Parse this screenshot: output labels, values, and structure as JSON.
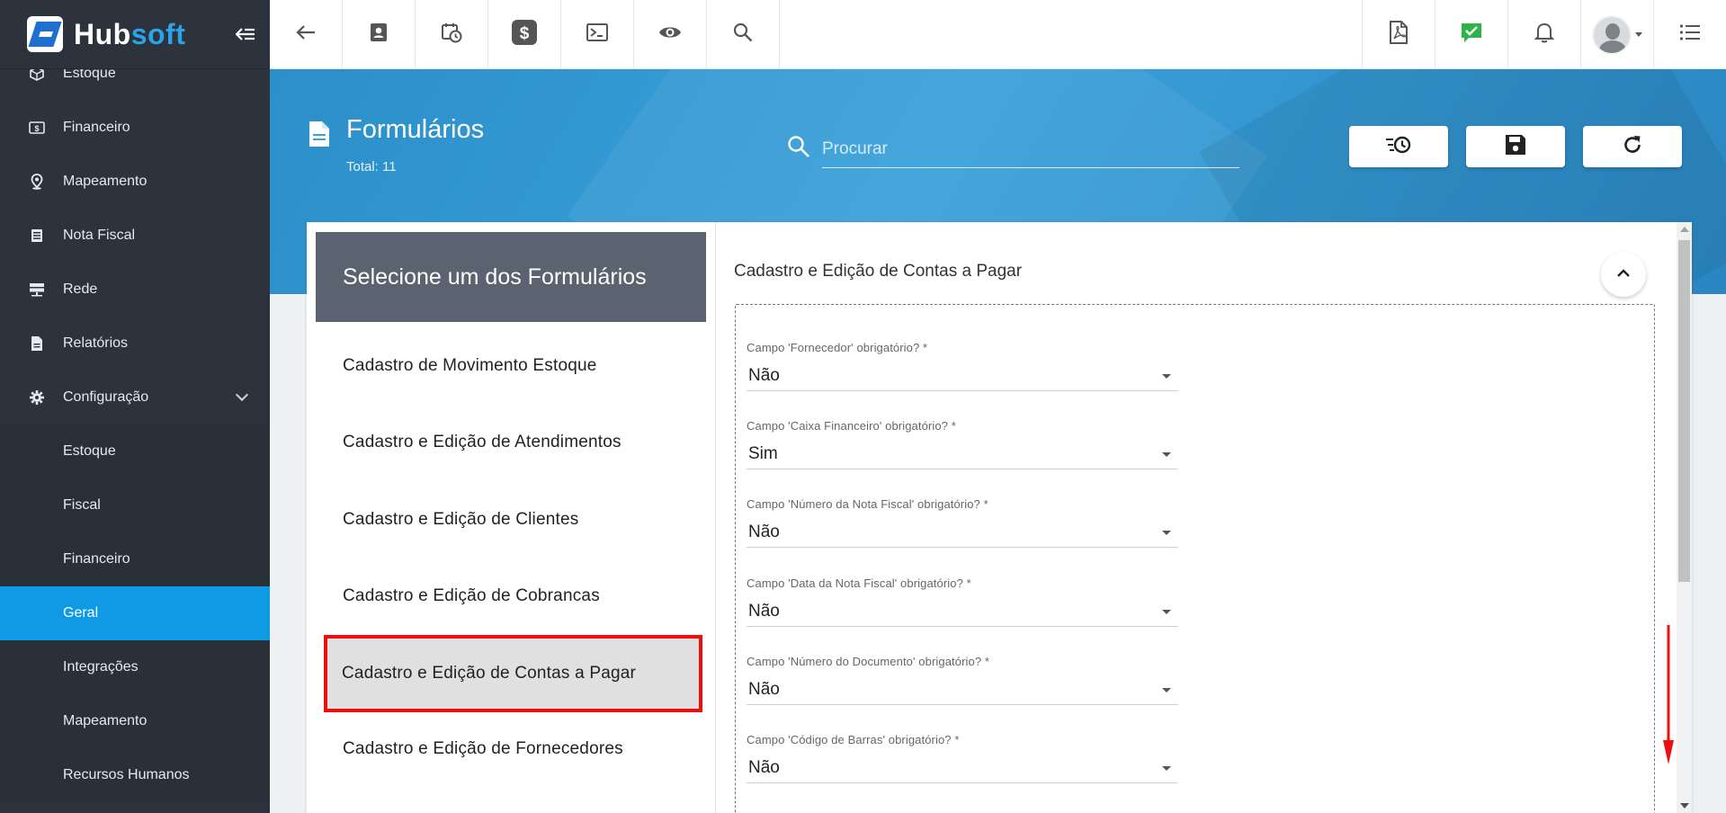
{
  "brand": {
    "name_part1": "Hub",
    "name_part2": "soft"
  },
  "sidebar": {
    "items": [
      {
        "label": "Estoque",
        "icon": "box-icon"
      },
      {
        "label": "Financeiro",
        "icon": "money-icon"
      },
      {
        "label": "Mapeamento",
        "icon": "map-pin-icon"
      },
      {
        "label": "Nota Fiscal",
        "icon": "document-icon"
      },
      {
        "label": "Rede",
        "icon": "server-icon"
      },
      {
        "label": "Relatórios",
        "icon": "report-icon"
      },
      {
        "label": "Configuração",
        "icon": "gear-icon",
        "expanded": true
      }
    ],
    "submenu": [
      {
        "label": "Estoque"
      },
      {
        "label": "Fiscal"
      },
      {
        "label": "Financeiro"
      },
      {
        "label": "Geral",
        "active": true
      },
      {
        "label": "Integrações"
      },
      {
        "label": "Mapeamento"
      },
      {
        "label": "Recursos Humanos"
      }
    ]
  },
  "topbar": {
    "left_icons": [
      "back-arrow-icon",
      "contact-card-icon",
      "calendar-clock-icon",
      "dollar-icon",
      "terminal-icon",
      "eye-icon",
      "search-icon"
    ],
    "right_icons": [
      "pdf-icon",
      "chat-check-icon",
      "bell-icon",
      "avatar",
      "list-menu-icon"
    ]
  },
  "header": {
    "title": "Formulários",
    "total": "Total: 11",
    "search_placeholder": "Procurar"
  },
  "forms_list": {
    "title": "Selecione um dos Formulários",
    "items": [
      {
        "label": "Cadastro de Movimento Estoque"
      },
      {
        "label": "Cadastro e Edição de Atendimentos"
      },
      {
        "label": "Cadastro e Edição de Clientes"
      },
      {
        "label": "Cadastro e Edição de Cobrancas"
      },
      {
        "label": "Cadastro e Edição de Contas a Pagar",
        "selected": true
      },
      {
        "label": "Cadastro e Edição de Fornecedores"
      }
    ]
  },
  "detail": {
    "title": "Cadastro e Edição de Contas a Pagar",
    "fields": [
      {
        "label": "Campo 'Fornecedor' obrigatório? *",
        "value": "Não"
      },
      {
        "label": "Campo 'Caixa Financeiro' obrigatório? *",
        "value": "Sim"
      },
      {
        "label": "Campo 'Número da Nota Fiscal' obrigatório? *",
        "value": "Não"
      },
      {
        "label": "Campo 'Data da Nota Fiscal' obrigatório? *",
        "value": "Não"
      },
      {
        "label": "Campo 'Número do Documento' obrigatório? *",
        "value": "Não"
      },
      {
        "label": "Campo 'Código de Barras' obrigatório? *",
        "value": "Não"
      }
    ]
  },
  "colors": {
    "sidebar_bg": "#2c333d",
    "active_item": "#0e9ae4",
    "banner": "#3aa1da",
    "list_header": "#5b6270",
    "highlight": "#f00d0d"
  }
}
